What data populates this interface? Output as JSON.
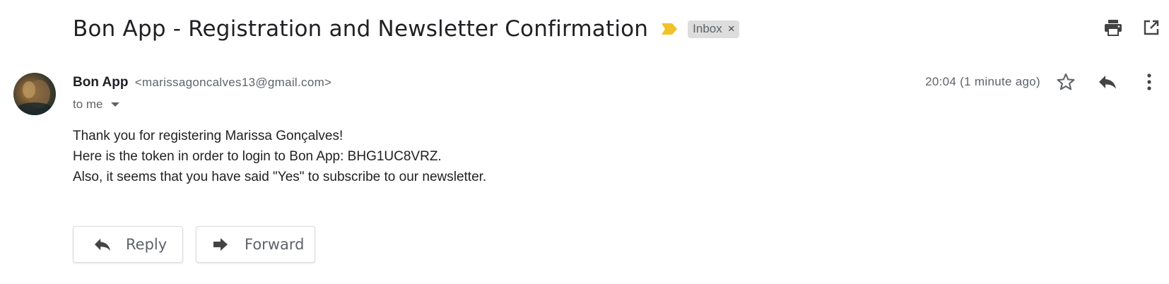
{
  "email": {
    "subject": "Bon App - Registration and Newsletter Confirmation",
    "label": "Inbox",
    "label_remove_glyph": "×",
    "sender_name": "Bon App",
    "sender_email": "<marissagoncalves13@gmail.com>",
    "recipient": "to me",
    "timestamp": "20:04 (1 minute ago)",
    "body_lines": [
      "Thank you for registering Marissa Gonçalves!",
      "Here is the token in order to login to Bon App: BHG1UC8VRZ.",
      "Also, it seems that you have said \"Yes\" to subscribe to our newsletter."
    ]
  },
  "actions": {
    "reply_label": "Reply",
    "forward_label": "Forward"
  },
  "icons": {
    "importance": "importance-marker-icon",
    "print": "print-icon",
    "open_new_window": "open-in-new-window-icon",
    "star": "star-icon",
    "reply": "reply-icon",
    "more": "more-vertical-icon",
    "caret": "caret-down-icon",
    "forward": "forward-icon"
  },
  "colors": {
    "importance": "#f2c128",
    "icon": "#5f6368",
    "chip_bg": "#dddddd",
    "text": "#202124",
    "secondary_text": "#5f6368"
  }
}
